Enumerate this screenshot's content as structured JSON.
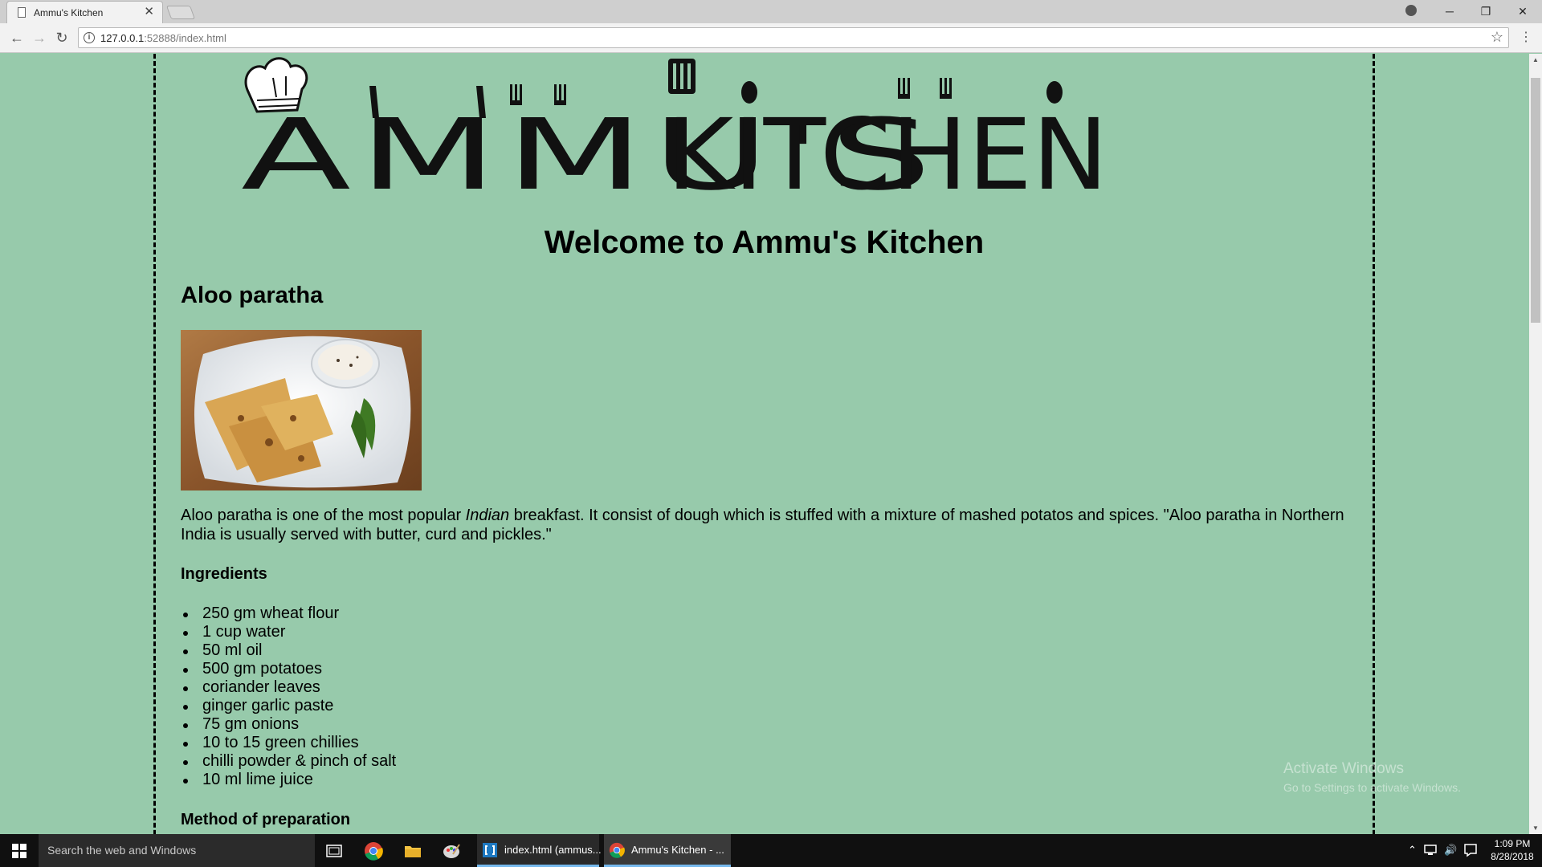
{
  "browser": {
    "tab_title": "Ammu's Kitchen",
    "tab_close": "✕",
    "url_host": "127.0.0.1",
    "url_rest": ":52888/index.html",
    "window_controls": {
      "minimize": "─",
      "restore": "❐",
      "close": "✕"
    }
  },
  "page": {
    "logo_text": "Ammu's Kitchen",
    "welcome": "Welcome to Ammu's Kitchen",
    "recipe_title": "Aloo paratha",
    "desc_before": "Aloo paratha is one of the most popular ",
    "desc_em": "Indian",
    "desc_after": " breakfast. It consist of dough which is stuffed with a mixture of mashed potatos and spices. \"Aloo paratha in Northern India is usually served with butter, curd and pickles.\"",
    "ingredients_heading": "Ingredients",
    "ingredients": [
      "250 gm wheat flour",
      "1 cup water",
      "50 ml oil",
      "500 gm potatoes",
      "coriander leaves",
      "ginger garlic paste",
      "75 gm onions",
      "10 to 15 green chillies",
      "chilli powder & pinch of salt",
      "10 ml lime juice"
    ],
    "method_heading": "Method of preparation",
    "background_color": "#97caab"
  },
  "watermark": {
    "line1": "Activate Windows",
    "line2": "Go to Settings to activate Windows."
  },
  "taskbar": {
    "search_placeholder": "Search the web and Windows",
    "task_brackets": "index.html (ammus...",
    "task_chrome": "Ammu's Kitchen - ...",
    "time": "1:09 PM",
    "date": "8/28/2018"
  }
}
